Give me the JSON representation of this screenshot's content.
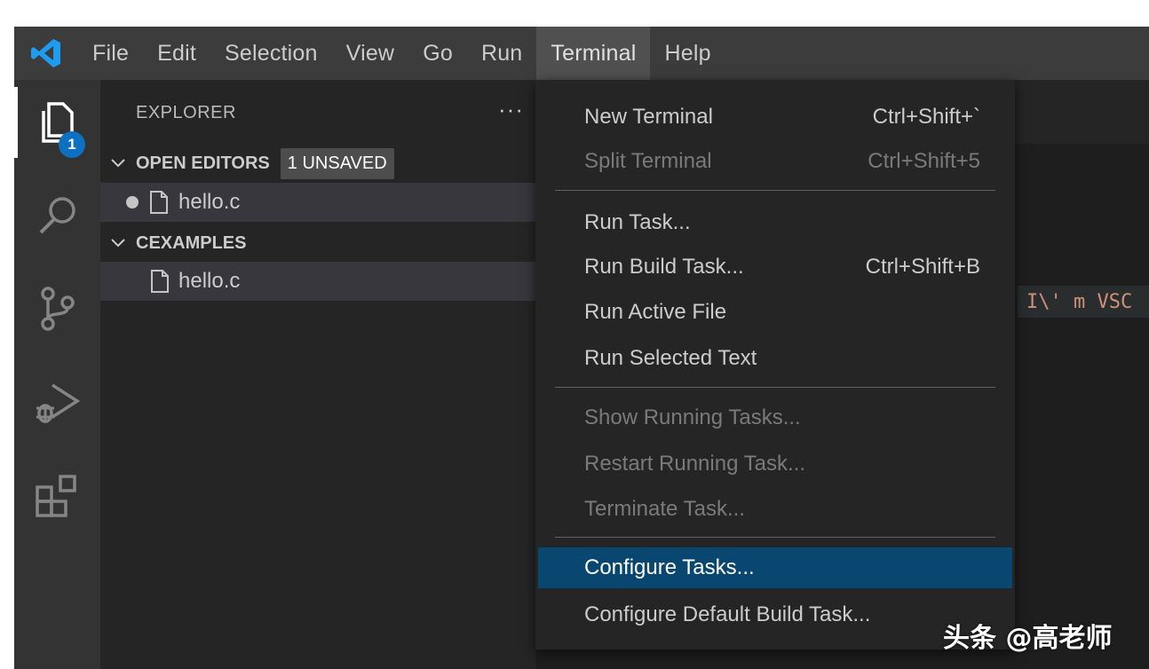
{
  "menubar": {
    "app_icon": "vscode-logo-icon",
    "items": [
      "File",
      "Edit",
      "Selection",
      "View",
      "Go",
      "Run",
      "Terminal",
      "Help"
    ],
    "open_menu": "Terminal"
  },
  "activitybar": {
    "explorer_badge": "1",
    "icons": [
      "explorer-icon",
      "search-icon",
      "source-control-icon",
      "run-debug-icon",
      "extensions-icon"
    ]
  },
  "sidebar": {
    "title": "EXPLORER",
    "more": "···",
    "open_editors": {
      "label": "OPEN EDITORS",
      "badge": "1 UNSAVED",
      "files": [
        "hello.c"
      ]
    },
    "folder": {
      "label": "CEXAMPLES",
      "files": [
        "hello.c"
      ]
    }
  },
  "editor": {
    "visible_code": "I\\' m VSC"
  },
  "terminal_menu": {
    "items": [
      {
        "label": "New Terminal",
        "shortcut": "Ctrl+Shift+`"
      },
      {
        "label": "Split Terminal",
        "shortcut": "Ctrl+Shift+5"
      },
      {
        "label": "Run Task...",
        "shortcut": ""
      },
      {
        "label": "Run Build Task...",
        "shortcut": "Ctrl+Shift+B"
      },
      {
        "label": "Run Active File",
        "shortcut": ""
      },
      {
        "label": "Run Selected Text",
        "shortcut": ""
      },
      {
        "label": "Show Running Tasks...",
        "shortcut": ""
      },
      {
        "label": "Restart Running Task...",
        "shortcut": ""
      },
      {
        "label": "Terminate Task...",
        "shortcut": ""
      },
      {
        "label": "Configure Tasks...",
        "shortcut": ""
      },
      {
        "label": "Configure Default Build Task...",
        "shortcut": ""
      }
    ]
  },
  "watermark": "头条 @高老师",
  "colors": {
    "menubar_bg": "#3c3c3c",
    "sidebar_bg": "#252526",
    "activitybar_bg": "#333333",
    "highlight": "#094771",
    "badge": "#0e70c0"
  }
}
